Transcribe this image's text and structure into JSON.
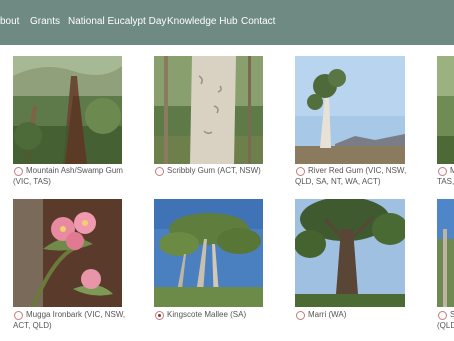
{
  "nav": {
    "items": [
      "bout",
      "Grants",
      "National Eucalypt Day",
      "Knowledge Hub",
      "Contact"
    ]
  },
  "species": [
    {
      "line1": "Mountain Ash/Swamp Gum",
      "line2": "(VIC, TAS)",
      "selected": false
    },
    {
      "line1": "Scribbly Gum (ACT, NSW)",
      "line2": "",
      "selected": false
    },
    {
      "line1": "River Red Gum (VIC, NSW,",
      "line2": "QLD, SA, NT, WA, ACT)",
      "selected": false
    },
    {
      "line1": "M",
      "line2": "TAS,",
      "selected": false
    },
    {
      "line1": "Mugga Ironbark (VIC, NSW,",
      "line2": "ACT, QLD)",
      "selected": false
    },
    {
      "line1": "Kingscote Mallee (SA)",
      "line2": "",
      "selected": true
    },
    {
      "line1": "Marri (WA)",
      "line2": "",
      "selected": false
    },
    {
      "line1": "S",
      "line2": "(QLD",
      "selected": false
    }
  ],
  "photo_icons": [
    "mountain-ash-photo",
    "scribbly-gum-photo",
    "river-red-gum-photo",
    "partial-tree-photo",
    "mugga-ironbark-flower-photo",
    "kingscote-mallee-photo",
    "marri-photo",
    "partial-tree-photo-2"
  ]
}
